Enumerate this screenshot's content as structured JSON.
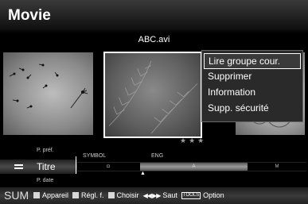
{
  "header": {
    "title": "Movie"
  },
  "file": {
    "name": "ABC.avi"
  },
  "context_menu": {
    "items": [
      {
        "label": "Lire groupe cour.",
        "selected": true
      },
      {
        "label": "Supprimer"
      },
      {
        "label": "Information"
      },
      {
        "label": "Supp. sécurité"
      }
    ]
  },
  "rating": {
    "stars": "★★★"
  },
  "sort": {
    "up": "P. préf.",
    "current": "Titre",
    "down": "P. date"
  },
  "index": {
    "symbol": "SYMBOL",
    "eng": "ENG",
    "seg_symbol": "◘",
    "seg_eng": "A",
    "seg_m": "M",
    "pointer": "▲"
  },
  "footer": {
    "sum": "SUM",
    "device": "Appareil",
    "settings": "Régl. f.",
    "choose": "Choisir",
    "jump_arrows": "◀◀ ▶▶",
    "jump": "Saut",
    "tools_key": "TOOLS",
    "option": "Option",
    "colors": {
      "red": "#d8d8d8",
      "green": "#d8d8d8",
      "yellow": "#d8d8d8"
    }
  }
}
